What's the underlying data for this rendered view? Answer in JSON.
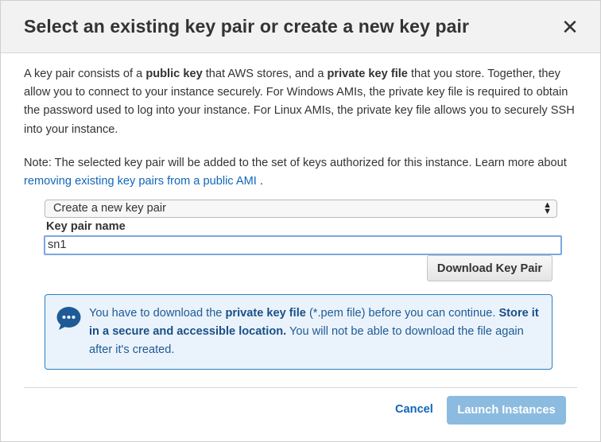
{
  "dialog": {
    "title": "Select an existing key pair or create a new key pair",
    "close_glyph": "✕"
  },
  "intro": {
    "t1": "A key pair consists of a ",
    "b1": "public key",
    "t2": " that AWS stores, and a ",
    "b2": "private key file",
    "t3": " that you store. Together, they allow you to connect to your instance securely. For Windows AMIs, the private key file is required to obtain the password used to log into your instance. For Linux AMIs, the private key file allows you to securely SSH into your instance."
  },
  "note": {
    "text": "Note: The selected key pair will be added to the set of keys authorized for this instance. Learn more about ",
    "link": "removing existing key pairs from a public AMI",
    "end": " ."
  },
  "select": {
    "value": "Create a new key pair",
    "arrows": "▲\n▼"
  },
  "key_name": {
    "label": "Key pair name",
    "value": "sn1"
  },
  "buttons": {
    "download": "Download Key Pair",
    "cancel": "Cancel",
    "launch": "Launch Instances"
  },
  "info": {
    "icon": "speech-bubble-icon",
    "t1": "You have to download the ",
    "b1": "private key file",
    "t2": " (*.pem file) before you can continue. ",
    "b2": "Store it in a secure and accessible location.",
    "t3": " You will not be able to download the file again after it's created."
  },
  "colors": {
    "link": "#1166bb",
    "info_border": "#2d7fc4",
    "info_bg": "#eaf3fb",
    "launch_bg": "#8cbbe0"
  }
}
